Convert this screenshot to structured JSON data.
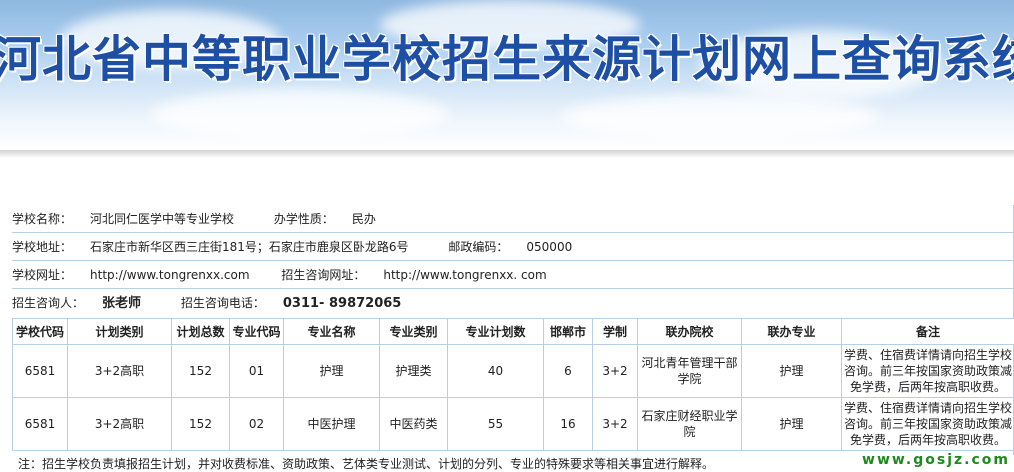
{
  "banner": {
    "title": "河北省中等职业学校招生来源计划网上查询系统"
  },
  "school": {
    "name_label": "学校名称：",
    "name": "河北同仁医学中等专业学校",
    "nature_label": "办学性质：",
    "nature": "民办",
    "address_label": "学校地址：",
    "address": "石家庄市新华区西三庄街181号；石家庄市鹿泉区卧龙路6号",
    "zip_label": "邮政编码：",
    "zip": "050000",
    "website_label": "学校网址：",
    "website": "http://www.tongrenxx.com",
    "admission_site_label": "招生咨询网址：",
    "admission_site": "http://www.tongrenxx. com",
    "contact_label": "招生咨询人：",
    "contact": "张老师",
    "phone_label": "招生咨询电话：",
    "phone": "0311- 89872065"
  },
  "table": {
    "headers": [
      "学校代码",
      "计划类别",
      "计划总数",
      "专业代码",
      "专业名称",
      "专业类别",
      "专业计划数",
      "邯郸市",
      "学制",
      "联办院校",
      "联办专业",
      "备注"
    ],
    "rows": [
      [
        "6581",
        "3+2高职",
        "152",
        "01",
        "护理",
        "护理类",
        "40",
        "6",
        "3+2",
        "河北青年管理干部学院",
        "护理",
        "学费、住宿费详情请向招生学校咨询。前三年按国家资助政策减免学费，后两年按高职收费。"
      ],
      [
        "6581",
        "3+2高职",
        "152",
        "02",
        "中医护理",
        "中医药类",
        "55",
        "16",
        "3+2",
        "石家庄财经职业学院",
        "护理",
        "学费、住宿费详情请向招生学校咨询。前三年按国家资助政策减免学费，后两年按高职收费。"
      ]
    ]
  },
  "note": "注：招生学校负责填报招生计划，并对收费标准、资助政策、艺体类专业测试、计划的分列、专业的特殊要求等相关事宜进行解释。",
  "watermark": "www.gosjz.com"
}
